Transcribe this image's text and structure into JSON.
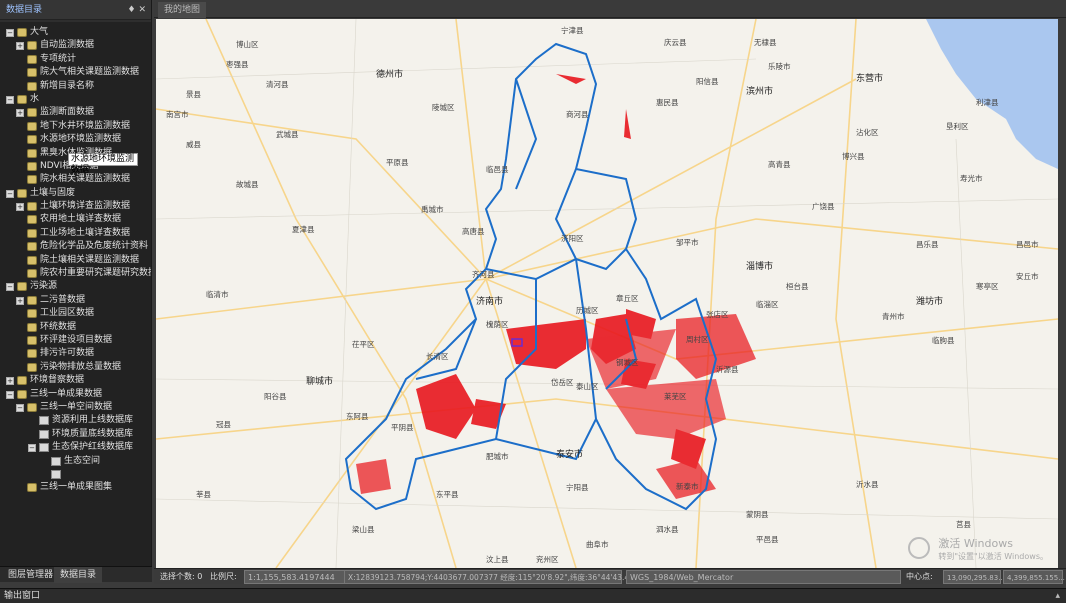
{
  "left_panel": {
    "title": "数据目录",
    "tools": "♦ ✕",
    "tooltip": "水源地环境监测数据",
    "tabs": [
      "图层管理器",
      "数据目录"
    ],
    "tree": [
      {
        "label": "大气",
        "level": 0,
        "toggle": "−",
        "icon": "db"
      },
      {
        "label": "自动监测数据",
        "level": 1,
        "toggle": "+",
        "icon": "db"
      },
      {
        "label": "专项统计",
        "level": 1,
        "toggle": "",
        "icon": "db"
      },
      {
        "label": "院大气相关课题监测数据",
        "level": 1,
        "toggle": "",
        "icon": "db"
      },
      {
        "label": "新增目录名称",
        "level": 1,
        "toggle": "",
        "icon": "db"
      },
      {
        "label": "水",
        "level": 0,
        "toggle": "−",
        "icon": "db"
      },
      {
        "label": "监测断面数据",
        "level": 1,
        "toggle": "+",
        "icon": "db"
      },
      {
        "label": "地下水井环境监测数据",
        "level": 1,
        "toggle": "",
        "icon": "db"
      },
      {
        "label": "水源地环境监测数据",
        "level": 1,
        "toggle": "",
        "icon": "db"
      },
      {
        "label": "黑臭水体监测数据",
        "level": 1,
        "toggle": "",
        "icon": "db"
      },
      {
        "label": "NDVI相关数据",
        "level": 1,
        "toggle": "",
        "icon": "db"
      },
      {
        "label": "院水相关课题监测数据",
        "level": 1,
        "toggle": "",
        "icon": "db"
      },
      {
        "label": "土壤与固废",
        "level": 0,
        "toggle": "−",
        "icon": "db"
      },
      {
        "label": "土壤环境详查监测数据",
        "level": 1,
        "toggle": "+",
        "icon": "db"
      },
      {
        "label": "农用地土壤详查数据",
        "level": 1,
        "toggle": "",
        "icon": "db"
      },
      {
        "label": "工业场地土壤详查数据",
        "level": 1,
        "toggle": "",
        "icon": "db"
      },
      {
        "label": "危险化学品及危废统计资料",
        "level": 1,
        "toggle": "",
        "icon": "db"
      },
      {
        "label": "院土壤相关课题监测数据",
        "level": 1,
        "toggle": "",
        "icon": "db"
      },
      {
        "label": "院农村重要研究课题研究数据",
        "level": 1,
        "toggle": "",
        "icon": "db"
      },
      {
        "label": "污染源",
        "level": 0,
        "toggle": "−",
        "icon": "db"
      },
      {
        "label": "二污普数据",
        "level": 1,
        "toggle": "+",
        "icon": "db"
      },
      {
        "label": "工业园区数据",
        "level": 1,
        "toggle": "",
        "icon": "db"
      },
      {
        "label": "环统数据",
        "level": 1,
        "toggle": "",
        "icon": "db"
      },
      {
        "label": "环评建设项目数据",
        "level": 1,
        "toggle": "",
        "icon": "db"
      },
      {
        "label": "排污许可数据",
        "level": 1,
        "toggle": "",
        "icon": "db"
      },
      {
        "label": "污染物排放总量数据",
        "level": 1,
        "toggle": "",
        "icon": "db"
      },
      {
        "label": "环境督察数据",
        "level": 0,
        "toggle": "+",
        "icon": "db"
      },
      {
        "label": "三线一单成果数据",
        "level": 0,
        "toggle": "−",
        "icon": "db"
      },
      {
        "label": "三线一单空间数据",
        "level": 1,
        "toggle": "−",
        "icon": "db"
      },
      {
        "label": "资源利用上线数据库",
        "level": 2,
        "toggle": "",
        "icon": "ly"
      },
      {
        "label": "环境质量底线数据库",
        "level": 2,
        "toggle": "",
        "icon": "ly"
      },
      {
        "label": "生态保护红线数据库",
        "level": 2,
        "toggle": "−",
        "icon": "ly"
      },
      {
        "label": "生态空间",
        "level": 3,
        "toggle": "",
        "icon": "ly"
      },
      {
        "label": "",
        "level": 3,
        "toggle": "",
        "icon": "ly",
        "selected": true
      },
      {
        "label": "三线一单成果图集",
        "level": 1,
        "toggle": "",
        "icon": "db"
      }
    ]
  },
  "map": {
    "tab": "我的地图",
    "watermark_title": "激活 Windows",
    "watermark_sub": "转到\"设置\"以激活 Windows。",
    "labels": [
      {
        "t": "德州市",
        "city": true
      },
      {
        "t": "滨州市",
        "city": true
      },
      {
        "t": "东营市",
        "city": true
      },
      {
        "t": "淄博市",
        "city": true
      },
      {
        "t": "潍坊市",
        "city": true
      },
      {
        "t": "聊城市",
        "city": true
      },
      {
        "t": "泰安市",
        "city": true
      },
      {
        "t": "济南市",
        "city": true
      },
      {
        "t": "商河县"
      },
      {
        "t": "惠民县"
      },
      {
        "t": "临邑县"
      },
      {
        "t": "济阳区"
      },
      {
        "t": "章丘区"
      },
      {
        "t": "长清区"
      },
      {
        "t": "平阴县"
      },
      {
        "t": "莱芜区"
      },
      {
        "t": "新泰市"
      },
      {
        "t": "肥城市"
      },
      {
        "t": "东阿县"
      },
      {
        "t": "齐河县"
      },
      {
        "t": "禹城市"
      },
      {
        "t": "邹平市"
      },
      {
        "t": "高青县"
      },
      {
        "t": "博兴县"
      },
      {
        "t": "广饶县"
      },
      {
        "t": "寿光市"
      },
      {
        "t": "青州市"
      },
      {
        "t": "临朐县"
      },
      {
        "t": "沂源县"
      },
      {
        "t": "蒙阴县"
      },
      {
        "t": "宁阳县"
      },
      {
        "t": "东平县"
      },
      {
        "t": "梁山县"
      },
      {
        "t": "阳谷县"
      },
      {
        "t": "茌平区"
      },
      {
        "t": "高唐县"
      },
      {
        "t": "夏津县"
      },
      {
        "t": "平原县"
      },
      {
        "t": "乐陵市"
      },
      {
        "t": "陵城区"
      },
      {
        "t": "宁津县"
      },
      {
        "t": "庆云县"
      },
      {
        "t": "无棣县"
      },
      {
        "t": "阳信县"
      },
      {
        "t": "沾化区"
      },
      {
        "t": "利津县"
      },
      {
        "t": "垦利区"
      },
      {
        "t": "昌乐县"
      },
      {
        "t": "安丘市"
      },
      {
        "t": "昌邑市"
      },
      {
        "t": "寒亭区"
      },
      {
        "t": "沂水县"
      },
      {
        "t": "莒县"
      },
      {
        "t": "平邑县"
      },
      {
        "t": "泗水县"
      },
      {
        "t": "曲阜市"
      },
      {
        "t": "兖州区"
      },
      {
        "t": "汶上县"
      },
      {
        "t": "冠县"
      },
      {
        "t": "莘县"
      },
      {
        "t": "临清市"
      },
      {
        "t": "武城县"
      },
      {
        "t": "故城县"
      },
      {
        "t": "景县"
      },
      {
        "t": "枣强县"
      },
      {
        "t": "南宫市"
      },
      {
        "t": "威县"
      },
      {
        "t": "清河县"
      },
      {
        "t": "博山区"
      },
      {
        "t": "周村区"
      },
      {
        "t": "张店区"
      },
      {
        "t": "临淄区"
      },
      {
        "t": "桓台县"
      },
      {
        "t": "槐荫区"
      },
      {
        "t": "历城区"
      },
      {
        "t": "钢城区"
      },
      {
        "t": "岱岳区"
      },
      {
        "t": "泰山区"
      }
    ]
  },
  "status": {
    "select_count": "选择个数: 0",
    "scale_label": "比例尺:",
    "scale_value": "1:1,155,583.4197444",
    "coords": "X:12839123.758794;Y:4403677.007377   经度:115°20'8.92\",纬度:36°44'43.41\"",
    "crs": "WGS_1984/Web_Mercator",
    "center_label": "中心点:",
    "center_x": "13,090,295.83...",
    "center_y": "4,399,855.155..."
  },
  "output": {
    "label": "输出窗口"
  },
  "colors": {
    "boundary": "#1c6ec9",
    "redline": "#e8161d",
    "sea": "#aac7ef",
    "land": "#f4f2ec",
    "road": "#f7d58b"
  }
}
